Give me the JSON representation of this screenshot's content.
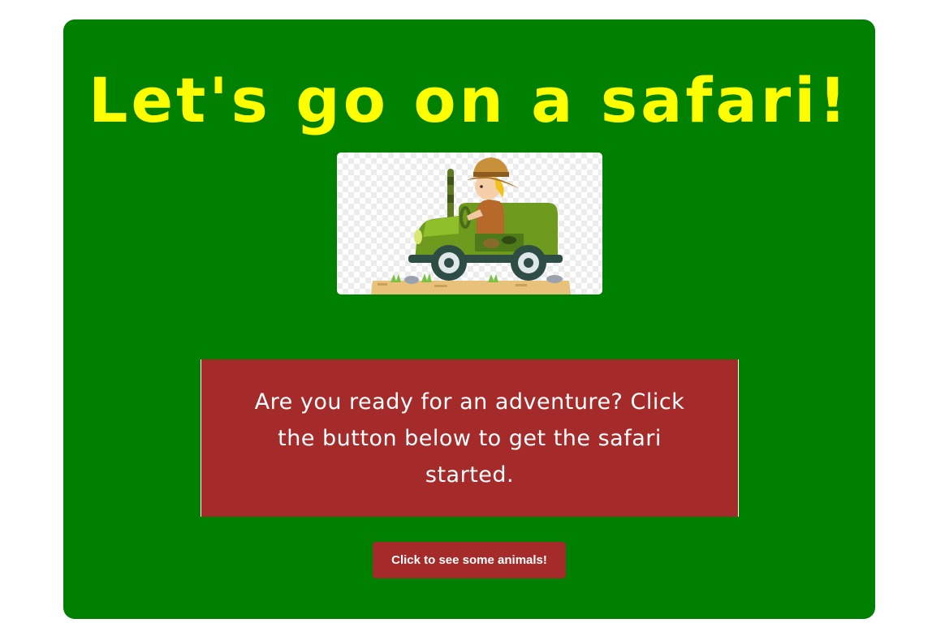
{
  "page": {
    "title": "Let's go on a safari!",
    "message": "Are you ready for an adventure? Click the button below to get the safari started.",
    "button_label": "Click to see some animals!"
  },
  "image": {
    "description_icon": "safari-jeep-icon"
  },
  "colors": {
    "page_background": "#ffffff",
    "card_background": "#008000",
    "title_color": "#ffff00",
    "message_background": "#a52a2a",
    "button_background": "#a52a2a",
    "text_color": "#ffffff"
  }
}
